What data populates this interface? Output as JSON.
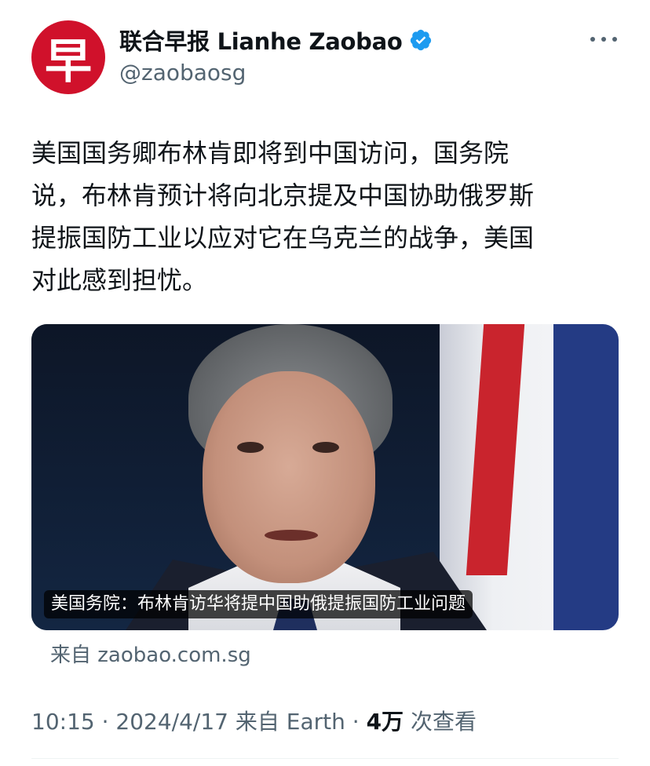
{
  "account": {
    "avatar_glyph": "早",
    "display_name": "联合早报 Lianhe Zaobao",
    "handle": "@zaobaosg",
    "verified_icon": "verified-badge-icon",
    "verified_color": "#1d9bf0",
    "brand_color": "#d0112b"
  },
  "tweet": {
    "lines": [
      "美国国务卿布林肯即将到中国访问，国务院",
      "说，布林肯预计将向北京提及中国协助俄罗斯",
      "提振国防工业以应对它在乌克兰的战争，美国",
      "对此感到担忧。"
    ]
  },
  "card": {
    "caption": "美国务院：布林肯访华将提中国助俄提振国防工业问题",
    "source": "来自 zaobao.com.sg"
  },
  "meta": {
    "time": "10:15 · 2024/4/17 来自 Earth · ",
    "views_count": "4万",
    "views_label": " 次查看"
  }
}
